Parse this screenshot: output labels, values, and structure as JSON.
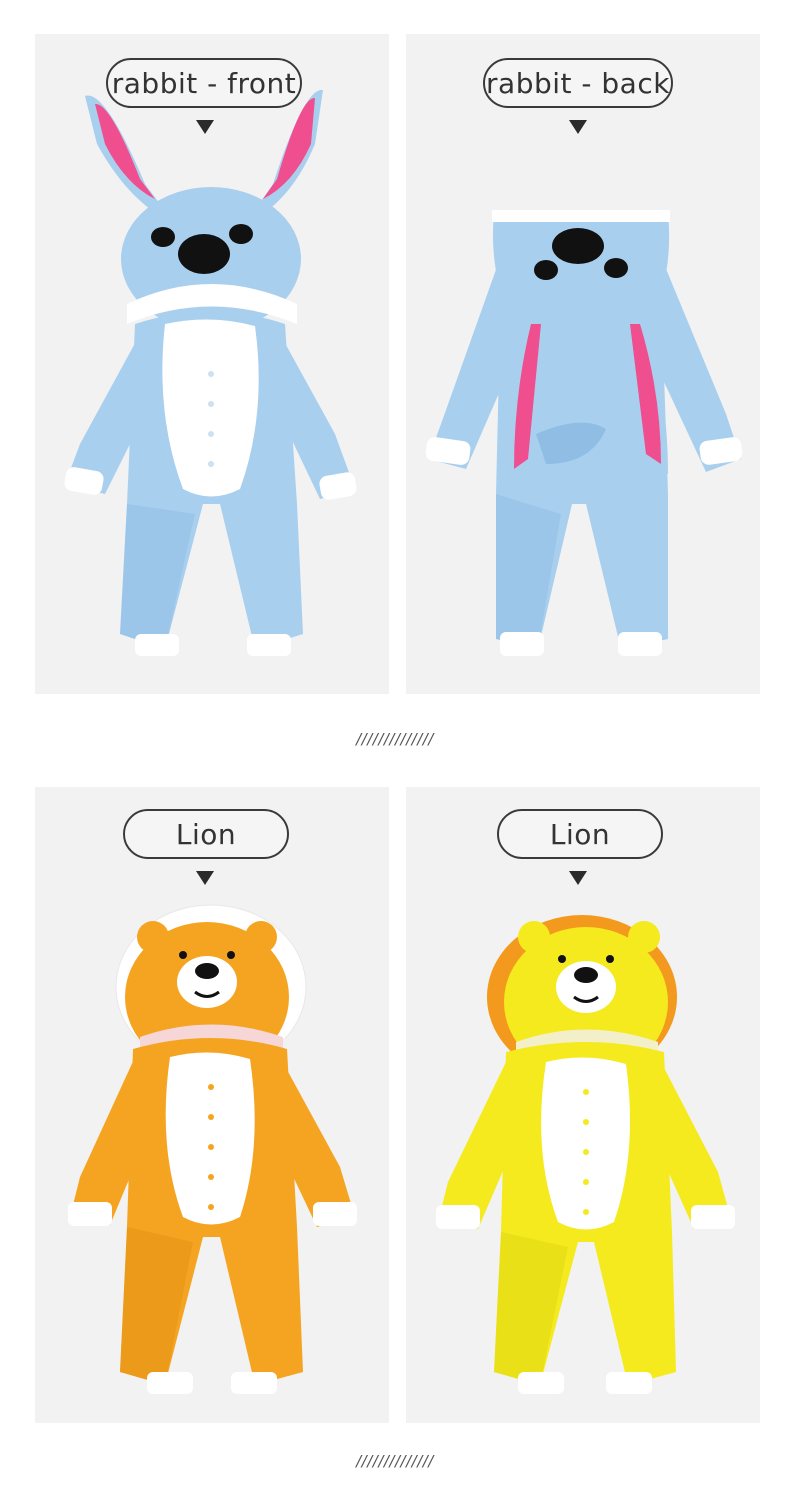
{
  "panels": [
    {
      "label": "rabbit - front",
      "garment": "rabbit-front",
      "colors": {
        "body": "#a9cfef",
        "body_shade": "#8fbde4",
        "belly": "#ffffff",
        "ear_inner": "#ef4f8e",
        "cuff": "#ffffff",
        "face": "#111111"
      }
    },
    {
      "label": "rabbit - back",
      "garment": "rabbit-back",
      "colors": {
        "body": "#a9cfef",
        "body_shade": "#8fbde4",
        "ear_inner": "#ef4f8e",
        "cuff": "#ffffff",
        "face": "#111111"
      }
    },
    {
      "label": "Lion",
      "garment": "lion-orange",
      "colors": {
        "body": "#f5a422",
        "body_shade": "#e38f12",
        "belly": "#ffffff",
        "mane": "#ffffff",
        "cuff": "#ffffff",
        "face": "#111111"
      }
    },
    {
      "label": "Lion",
      "garment": "lion-yellow",
      "colors": {
        "body": "#f4ea1e",
        "body_shade": "#e2d812",
        "belly": "#ffffff",
        "mane": "#f39a1e",
        "cuff": "#ffffff",
        "face": "#111111"
      }
    }
  ],
  "dividers": [
    "//////////////",
    "//////////////"
  ],
  "background": "#f2f2f2"
}
